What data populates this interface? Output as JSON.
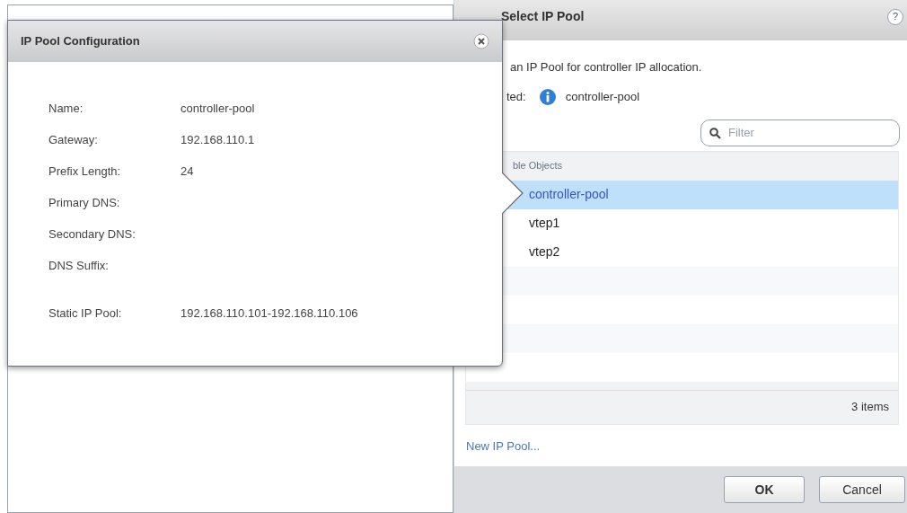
{
  "dialog": {
    "title": "Select IP Pool",
    "help": "?",
    "instruction": "an IP Pool for controller IP allocation.",
    "selected_label": "ted:",
    "selected_value": "controller-pool",
    "filter": {
      "placeholder": "Filter"
    },
    "list": {
      "header": "ble Objects",
      "rows": [
        {
          "label": "controller-pool",
          "selected": true
        },
        {
          "label": "vtep1",
          "selected": false
        },
        {
          "label": "vtep2",
          "selected": false
        }
      ],
      "footer": "3 items"
    },
    "link": "New IP Pool...",
    "buttons": [
      "OK",
      "Cancel"
    ]
  },
  "popup": {
    "title": "IP Pool Configuration",
    "fields": [
      {
        "label": "Name:",
        "value": "controller-pool"
      },
      {
        "label": "Gateway:",
        "value": "192.168.110.1"
      },
      {
        "label": "Prefix Length:",
        "value": "24"
      },
      {
        "label": "Primary DNS:"
      },
      {
        "label": "Secondary DNS:"
      },
      {
        "label": "DNS Suffix:"
      },
      {
        "label": "Static IP Pool:",
        "value": "192.168.110.101-192.168.110.106"
      }
    ]
  }
}
